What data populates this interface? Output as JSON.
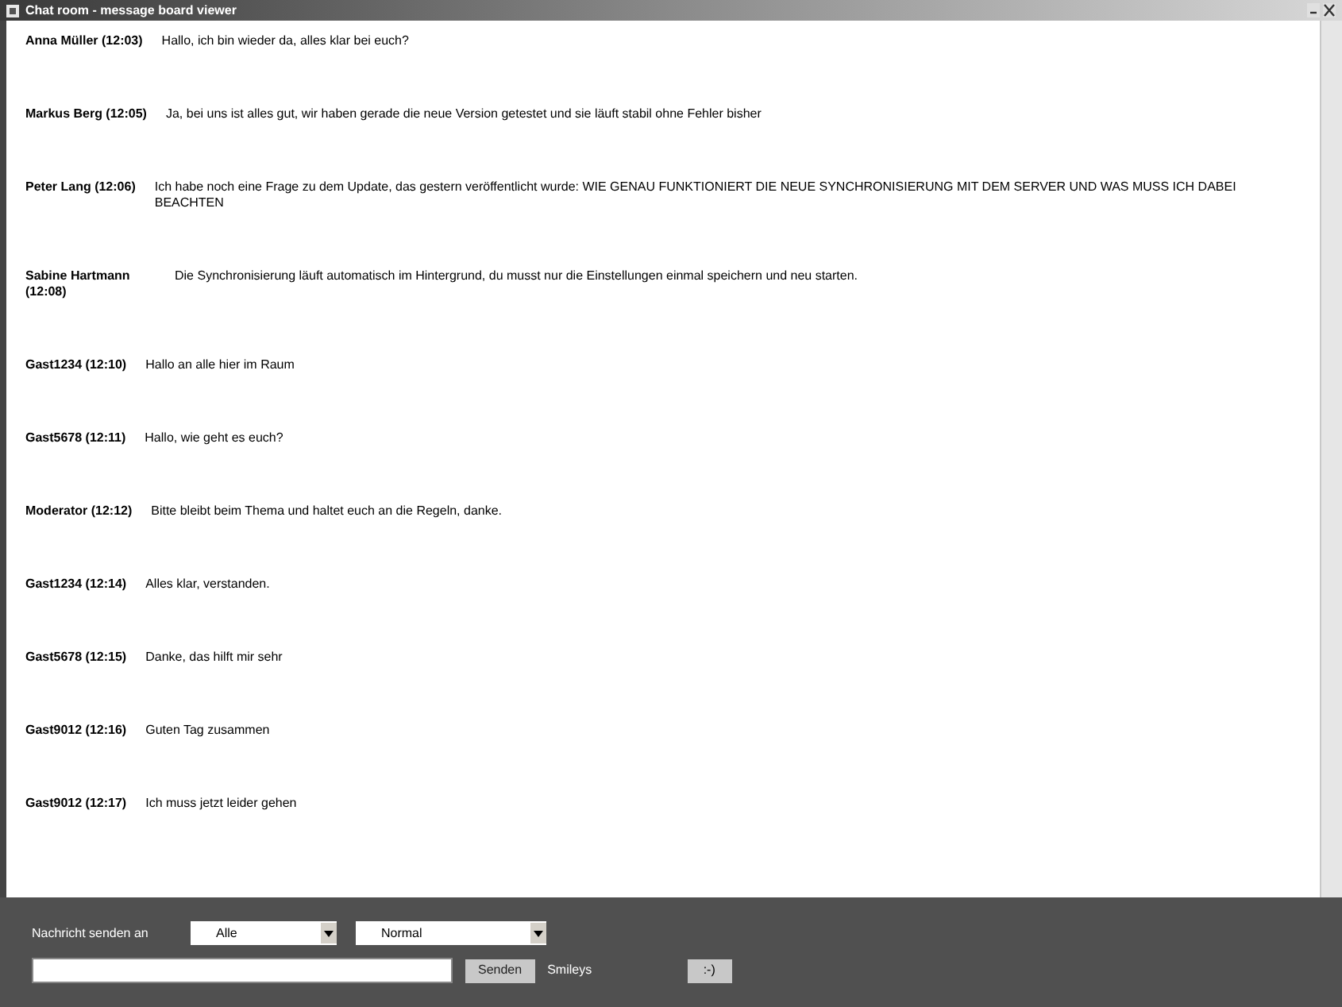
{
  "window": {
    "title": "Chat room - message board viewer"
  },
  "messages": [
    {
      "sender": "Anna Müller (12:03)",
      "text": "Hallo, ich bin wieder da, alles klar bei euch?"
    },
    {
      "sender": "Markus Berg (12:05)",
      "text": "Ja, bei uns ist alles gut, wir haben gerade die neue Version getestet und sie läuft stabil ohne Fehler bisher"
    },
    {
      "sender": "Peter Lang (12:06)",
      "text": "Ich habe noch eine Frage zu dem Update, das gestern veröffentlicht wurde: WIE GENAU FUNKTIONIERT DIE NEUE SYNCHRONISIERUNG MIT DEM SERVER UND WAS MUSS ICH DABEI BEACHTEN"
    },
    {
      "sender": "Sabine Hartmann (12:08)",
      "text": "Die Synchronisierung läuft automatisch im Hintergrund, du musst nur die Einstellungen einmal speichern und neu starten."
    },
    {
      "sender": "Gast1234 (12:10)",
      "text": "Hallo an alle hier im Raum"
    },
    {
      "sender": "Gast5678 (12:11)",
      "text": "Hallo, wie geht es euch?"
    },
    {
      "sender": "Moderator (12:12)",
      "text": "Bitte bleibt beim Thema und haltet euch an die Regeln, danke."
    },
    {
      "sender": "Gast1234 (12:14)",
      "text": "Alles klar, verstanden."
    },
    {
      "sender": "Gast5678 (12:15)",
      "text": "Danke, das hilft mir sehr"
    },
    {
      "sender": "Gast9012 (12:16)",
      "text": "Guten Tag zusammen"
    },
    {
      "sender": "Gast9012 (12:17)",
      "text": "Ich muss jetzt leider gehen"
    }
  ],
  "controls": {
    "label": "Nachricht senden an",
    "select_1": "Alle",
    "select_2": "Normal",
    "send_button": "Senden",
    "smileys_label": "Smileys",
    "smiley_button": ":-)"
  }
}
